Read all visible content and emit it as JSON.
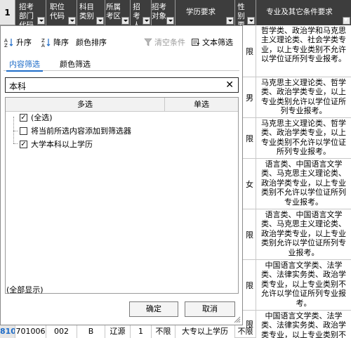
{
  "spreadsheet": {
    "row_number_header": "1",
    "headers": [
      {
        "label": "招考部门\n代码",
        "filtered": false
      },
      {
        "label": "职位\n代码",
        "filtered": false
      },
      {
        "label": "科目\n类别",
        "filtered": false
      },
      {
        "label": "所属\n考区",
        "filtered": false
      },
      {
        "label": "招考\n人数",
        "filtered": false
      },
      {
        "label": "招考\n对象",
        "filtered": false
      },
      {
        "label": "学历要求",
        "filtered": false
      },
      {
        "label": "性别\n要求",
        "filtered": false
      },
      {
        "label": "专业及其它条件要求",
        "filtered": true
      }
    ],
    "gender_col": [
      "限",
      "男",
      "限",
      "女",
      "限",
      "限",
      "限"
    ],
    "requirement_col": [
      "哲学类、政治学和马克思主义理论类、社会学类专业，以上专业类别不允许以学位证所列专业报考。",
      "马克思主义理论类、哲学类、政治学类专业，以上专业类别允许以学位证所列专业报考。",
      "马克思主义理论类、哲学类、政治学类专业，以上专业类别不允许以学位证所列专业报考。",
      "语言类、中国语言文学类、马克思主义理论类、政治学类专业，以上专业类别不允许以学位证所列专业报考。",
      "语言类、中国语言文学类、马克思主义理论类、政治学类专业，以上专业类别允许以学位证所列专业报考。",
      "中国语言文学类、法学类、法律实务类、政治学类专业，以上专业类别不允许以学位证所列专业报考。",
      "中国语言文学类、法学类、法律实务类、政治学类专业，以上专业类别不允许以学位证所列专业报考。"
    ],
    "bottom_row": [
      "810",
      "701006",
      "002",
      "B",
      "辽源",
      "1",
      "不限",
      "大专以上学历",
      "不限"
    ]
  },
  "filter_panel": {
    "sort_asc": "升序",
    "sort_desc": "降序",
    "sort_color": "颜色排序",
    "clear_filter": "清空条件",
    "text_filter": "文本筛选",
    "tab_content": "内容筛选",
    "tab_color": "颜色筛选",
    "search_value": "本科",
    "col_multi": "多选",
    "col_single": "单选",
    "items": [
      {
        "label": "(全选)",
        "checked": true
      },
      {
        "label": "将当前所选内容添加到筛选器",
        "checked": false
      },
      {
        "label": "大学本科以上学历",
        "checked": true
      }
    ],
    "show_all": "(全部显示)",
    "ok": "确定",
    "cancel": "取消"
  },
  "colors": {
    "accent": "#1e6cc8",
    "header_bg": "#3d3d3d",
    "bottom_row_num": "#1e6cc8"
  }
}
